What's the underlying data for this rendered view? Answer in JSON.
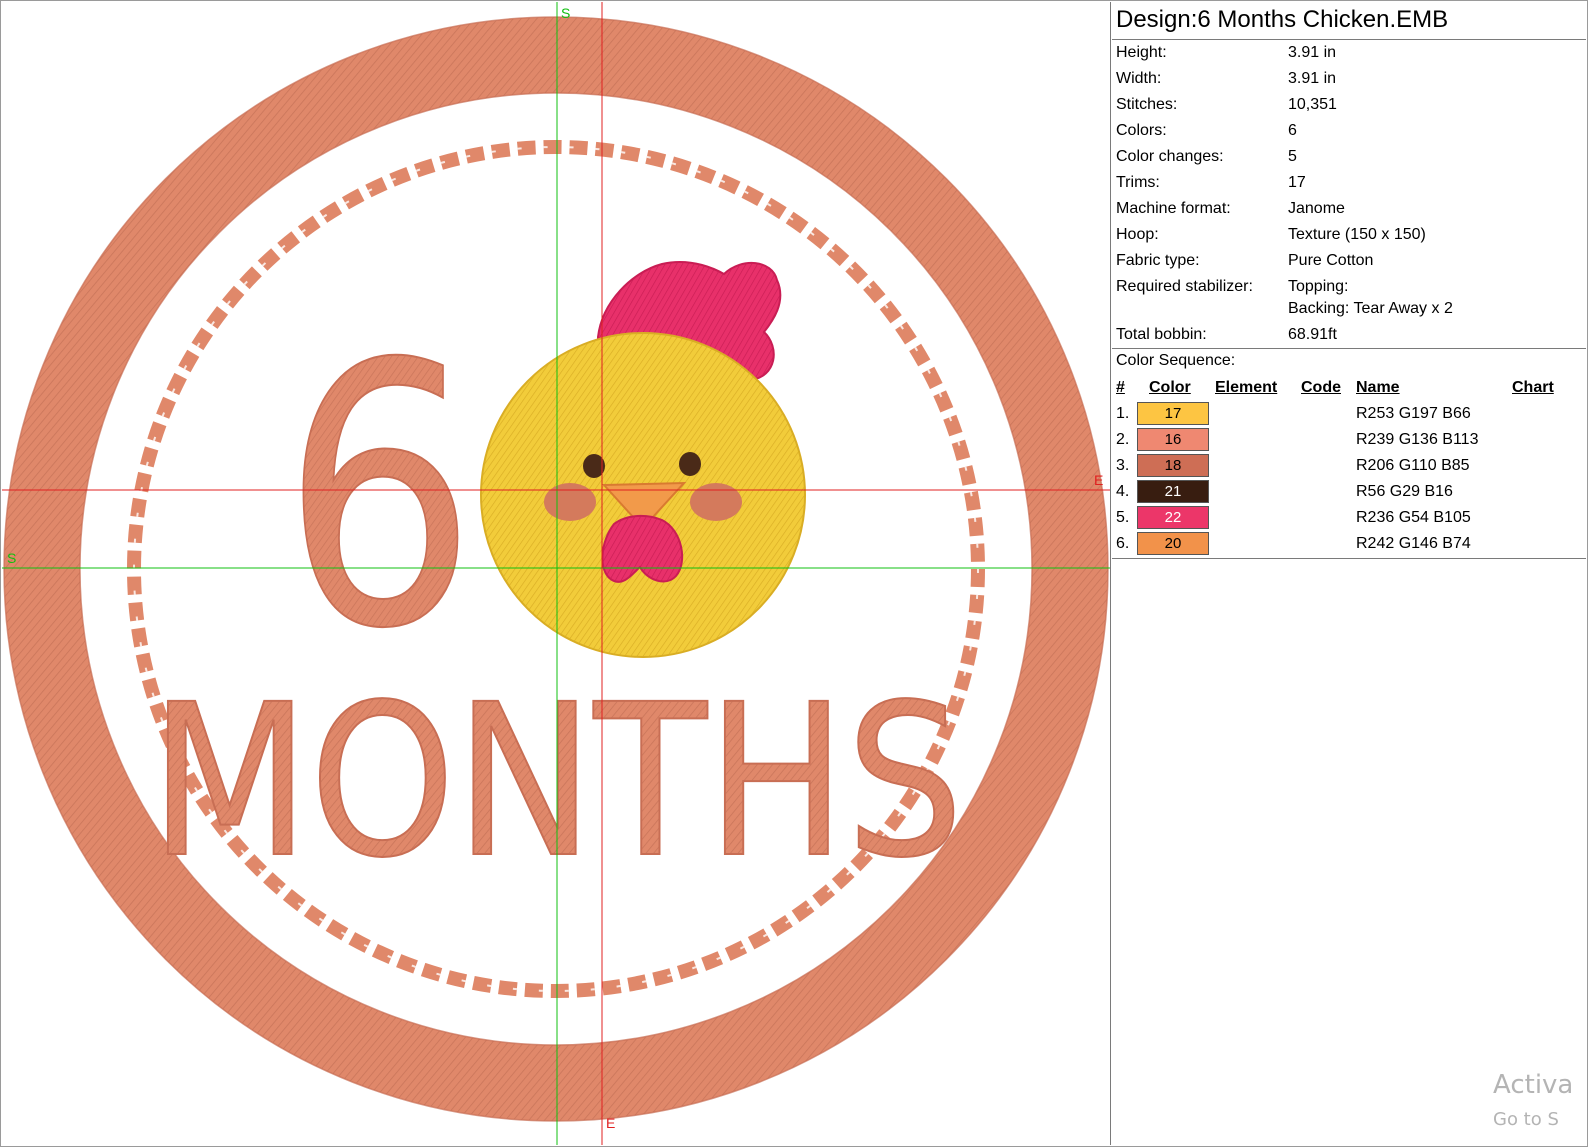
{
  "design": {
    "title": "Design:6 Months Chicken.EMB",
    "numeral": "6",
    "word": "MONTHS"
  },
  "axis_markers": {
    "start_top": "S",
    "start_left": "S",
    "end_right": "E",
    "end_bottom": "E"
  },
  "properties": [
    {
      "label": "Height:",
      "value": "3.91 in"
    },
    {
      "label": "Width:",
      "value": "3.91 in"
    },
    {
      "label": "Stitches:",
      "value": "10,351"
    },
    {
      "label": "Colors:",
      "value": "6"
    },
    {
      "label": "Color changes:",
      "value": "5"
    },
    {
      "label": "Trims:",
      "value": "17"
    },
    {
      "label": "Machine format:",
      "value": "Janome"
    },
    {
      "label": "Hoop:",
      "value": "Texture (150 x 150)"
    },
    {
      "label": "Fabric type:",
      "value": "Pure Cotton"
    },
    {
      "label": "Required stabilizer:",
      "value": "Topping:",
      "value2": "Backing: Tear Away x 2"
    },
    {
      "label": "Total bobbin:",
      "value": "68.91ft"
    }
  ],
  "color_sequence": {
    "title": "Color Sequence:",
    "headers": {
      "num": "#",
      "color": "Color",
      "element": "Element",
      "code": "Code",
      "name": "Name",
      "chart": "Chart"
    },
    "rows": [
      {
        "num": "1.",
        "code": "17",
        "name": "R253 G197 B66",
        "hex": "#fdc542",
        "text_color": "#000000"
      },
      {
        "num": "2.",
        "code": "16",
        "name": "R239 G136 B113",
        "hex": "#ef8871",
        "text_color": "#000000"
      },
      {
        "num": "3.",
        "code": "18",
        "name": "R206 G110 B85",
        "hex": "#ce6e55",
        "text_color": "#000000"
      },
      {
        "num": "4.",
        "code": "21",
        "name": "R56 G29 B16",
        "hex": "#381d10",
        "text_color": "#ffffff"
      },
      {
        "num": "5.",
        "code": "22",
        "name": "R236 G54 B105",
        "hex": "#ec3669",
        "text_color": "#ffffff"
      },
      {
        "num": "6.",
        "code": "20",
        "name": "R242 G146 B74",
        "hex": "#f2924a",
        "text_color": "#000000"
      }
    ]
  },
  "colors": {
    "thread_main": "#e0886a",
    "thread_dark": "#c86e54",
    "chick_yellow": "#f2cc3a",
    "comb_pink": "#e8306a",
    "beak_orange": "#f29a4a",
    "eye_brown": "#4a2a18",
    "cheek": "#d47a5c",
    "guide_green": "#10c010",
    "guide_red": "#e02020"
  },
  "watermark": {
    "line1": "Activa",
    "line2": "Go to S"
  }
}
